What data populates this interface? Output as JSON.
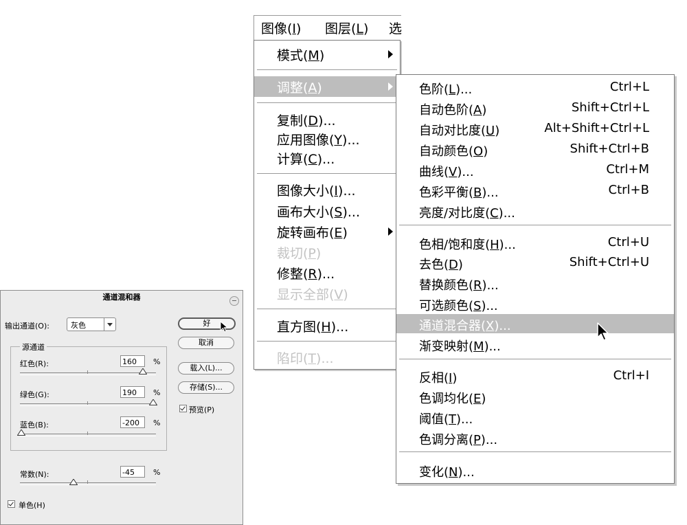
{
  "menubar": {
    "image": {
      "text": "图像(",
      "key": "I",
      "end": ")"
    },
    "layer": {
      "text": "图层(",
      "key": "L",
      "end": ")"
    },
    "select": {
      "text": "选"
    }
  },
  "image_menu": {
    "mode": {
      "text": "模式(",
      "key": "M",
      "end": ")"
    },
    "adjust": {
      "text": "调整(",
      "key": "A",
      "end": ")"
    },
    "duplicate": {
      "text": "复制(",
      "key": "D",
      "end": ")..."
    },
    "apply_image": {
      "text": "应用图像(",
      "key": "Y",
      "end": ")..."
    },
    "calculations": {
      "text": "计算(",
      "key": "C",
      "end": ")..."
    },
    "image_size": {
      "text": "图像大小(",
      "key": "I",
      "end": ")..."
    },
    "canvas_size": {
      "text": "画布大小(",
      "key": "S",
      "end": ")..."
    },
    "rotate_canvas": {
      "text": "旋转画布(",
      "key": "E",
      "end": ")"
    },
    "crop": {
      "text": "裁切(",
      "key": "P",
      "end": ")"
    },
    "trim": {
      "text": "修整(",
      "key": "R",
      "end": ")..."
    },
    "reveal_all": {
      "text": "显示全部(",
      "key": "V",
      "end": ")"
    },
    "histogram": {
      "text": "直方图(",
      "key": "H",
      "end": ")..."
    },
    "trap": {
      "text": "陷印(",
      "key": "T",
      "end": ")..."
    }
  },
  "adjust_menu": {
    "levels": {
      "text": "色阶(",
      "key": "L",
      "end": ")...",
      "shortcut": "Ctrl+L"
    },
    "auto_levels": {
      "text": "自动色阶(",
      "key": "A",
      "end": ")",
      "shortcut": "Shift+Ctrl+L"
    },
    "auto_contrast": {
      "text": "自动对比度(",
      "key": "U",
      "end": ")",
      "shortcut": "Alt+Shift+Ctrl+L"
    },
    "auto_color": {
      "text": "自动颜色(",
      "key": "O",
      "end": ")",
      "shortcut": "Shift+Ctrl+B"
    },
    "curves": {
      "text": "曲线(",
      "key": "V",
      "end": ")...",
      "shortcut": "Ctrl+M"
    },
    "color_balance": {
      "text": "色彩平衡(",
      "key": "B",
      "end": ")...",
      "shortcut": "Ctrl+B"
    },
    "brightness_contrast": {
      "text": "亮度/对比度(",
      "key": "C",
      "end": ")..."
    },
    "hue_saturation": {
      "text": "色相/饱和度(",
      "key": "H",
      "end": ")...",
      "shortcut": "Ctrl+U"
    },
    "desaturate": {
      "text": "去色(",
      "key": "D",
      "end": ")",
      "shortcut": "Shift+Ctrl+U"
    },
    "replace_color": {
      "text": "替换颜色(",
      "key": "R",
      "end": ")..."
    },
    "selective_color": {
      "text": "可选颜色(",
      "key": "S",
      "end": ")..."
    },
    "channel_mixer": {
      "text": "通道混合器(",
      "key": "X",
      "end": ")..."
    },
    "gradient_map": {
      "text": "渐变映射(",
      "key": "M",
      "end": ")..."
    },
    "invert": {
      "text": "反相(",
      "key": "I",
      "end": ")",
      "shortcut": "Ctrl+I"
    },
    "equalize": {
      "text": "色调均化(",
      "key": "E",
      "end": ")"
    },
    "threshold": {
      "text": "阈值(",
      "key": "T",
      "end": ")..."
    },
    "posterize": {
      "text": "色调分离(",
      "key": "P",
      "end": ")..."
    },
    "variations": {
      "text": "变化(",
      "key": "N",
      "end": ")..."
    }
  },
  "dialog": {
    "title": "通道混和器",
    "output_label": "输出通道(O):",
    "output_value": "灰色",
    "source_group": "源通道",
    "red_label": "红色(R):",
    "red_value": "160",
    "green_label": "绿色(G):",
    "green_value": "190",
    "blue_label": "蓝色(B):",
    "blue_value": "-200",
    "constant_label": "常数(N):",
    "constant_value": "-45",
    "percent": "%",
    "ok": "好",
    "cancel": "取消",
    "load": "载入(L)...",
    "save": "存储(S)...",
    "preview": "预览(P)",
    "monochrome": "单色(H)",
    "preview_checked": true,
    "monochrome_checked": true
  }
}
